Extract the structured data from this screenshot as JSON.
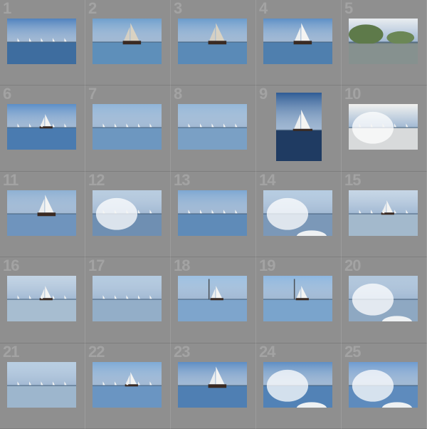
{
  "grid": {
    "columns": 5,
    "photos": [
      {
        "number": "1",
        "scene": "boats-far",
        "sky": "#4f82be",
        "water": "#3e6d9f",
        "orientation": "landscape"
      },
      {
        "number": "2",
        "scene": "sailboat-dark",
        "sky": "#6f9fcd",
        "water": "#5e8fba",
        "orientation": "landscape"
      },
      {
        "number": "3",
        "scene": "sailboat-dark",
        "sky": "#6a9bcc",
        "water": "#5a8ab7",
        "orientation": "landscape"
      },
      {
        "number": "4",
        "scene": "sailboat-white",
        "sky": "#5d8fc6",
        "water": "#4f7fae",
        "orientation": "landscape"
      },
      {
        "number": "5",
        "scene": "trees-shore",
        "sky": "#e9edf0",
        "water": "#6c7c82",
        "orientation": "landscape"
      },
      {
        "number": "6",
        "scene": "sailboat-small",
        "sky": "#5b8ec7",
        "water": "#4a7bb0",
        "orientation": "landscape"
      },
      {
        "number": "7",
        "scene": "boats-far",
        "sky": "#8fb4d8",
        "water": "#6d97c0",
        "orientation": "landscape"
      },
      {
        "number": "8",
        "scene": "boats-far",
        "sky": "#94b7d8",
        "water": "#7aa0c5",
        "orientation": "landscape"
      },
      {
        "number": "9",
        "scene": "night-boat",
        "sky": "#2f5c95",
        "water": "#1f3b62",
        "orientation": "portrait"
      },
      {
        "number": "10",
        "scene": "glare",
        "sky": "#f1f1ee",
        "water": "#d8dadb",
        "orientation": "landscape"
      },
      {
        "number": "11",
        "scene": "sailboat-white",
        "sky": "#8eb0d3",
        "water": "#6f94bd",
        "orientation": "landscape"
      },
      {
        "number": "12",
        "scene": "glare",
        "sky": "#b9cde0",
        "water": "#6f8fb2",
        "orientation": "landscape"
      },
      {
        "number": "13",
        "scene": "boats-far",
        "sky": "#7da7d2",
        "water": "#5f8bb8",
        "orientation": "landscape"
      },
      {
        "number": "14",
        "scene": "glare-bow",
        "sky": "#b7cde2",
        "water": "#7b98b8",
        "orientation": "landscape"
      },
      {
        "number": "15",
        "scene": "sailboat-small",
        "sky": "#c7d7e6",
        "water": "#a3b9cc",
        "orientation": "landscape"
      },
      {
        "number": "16",
        "scene": "sailboat-small",
        "sky": "#c3d4e4",
        "water": "#a7bdd0",
        "orientation": "landscape"
      },
      {
        "number": "17",
        "scene": "boats-far",
        "sky": "#b4cbe0",
        "water": "#93aec8",
        "orientation": "landscape"
      },
      {
        "number": "18",
        "scene": "sailboat-tower",
        "sky": "#9cc0e2",
        "water": "#7ea5cc",
        "orientation": "landscape"
      },
      {
        "number": "19",
        "scene": "sailboat-tower",
        "sky": "#8db7e0",
        "water": "#7aa4cc",
        "orientation": "landscape"
      },
      {
        "number": "20",
        "scene": "glare-bow",
        "sky": "#b1c7dc",
        "water": "#8ea8c2",
        "orientation": "landscape"
      },
      {
        "number": "21",
        "scene": "boats-far",
        "sky": "#b8cee2",
        "water": "#9db6cd",
        "orientation": "landscape"
      },
      {
        "number": "22",
        "scene": "sailboat-small",
        "sky": "#7eaad6",
        "water": "#6a95c2",
        "orientation": "landscape"
      },
      {
        "number": "23",
        "scene": "sailboat-white",
        "sky": "#5d8dc4",
        "water": "#4f7fb3",
        "orientation": "landscape"
      },
      {
        "number": "24",
        "scene": "glare-bow",
        "sky": "#5e8ec4",
        "water": "#5282b6",
        "orientation": "landscape"
      },
      {
        "number": "25",
        "scene": "glare-bow",
        "sky": "#6e9bd0",
        "water": "#5e8bbd",
        "orientation": "landscape"
      }
    ]
  }
}
